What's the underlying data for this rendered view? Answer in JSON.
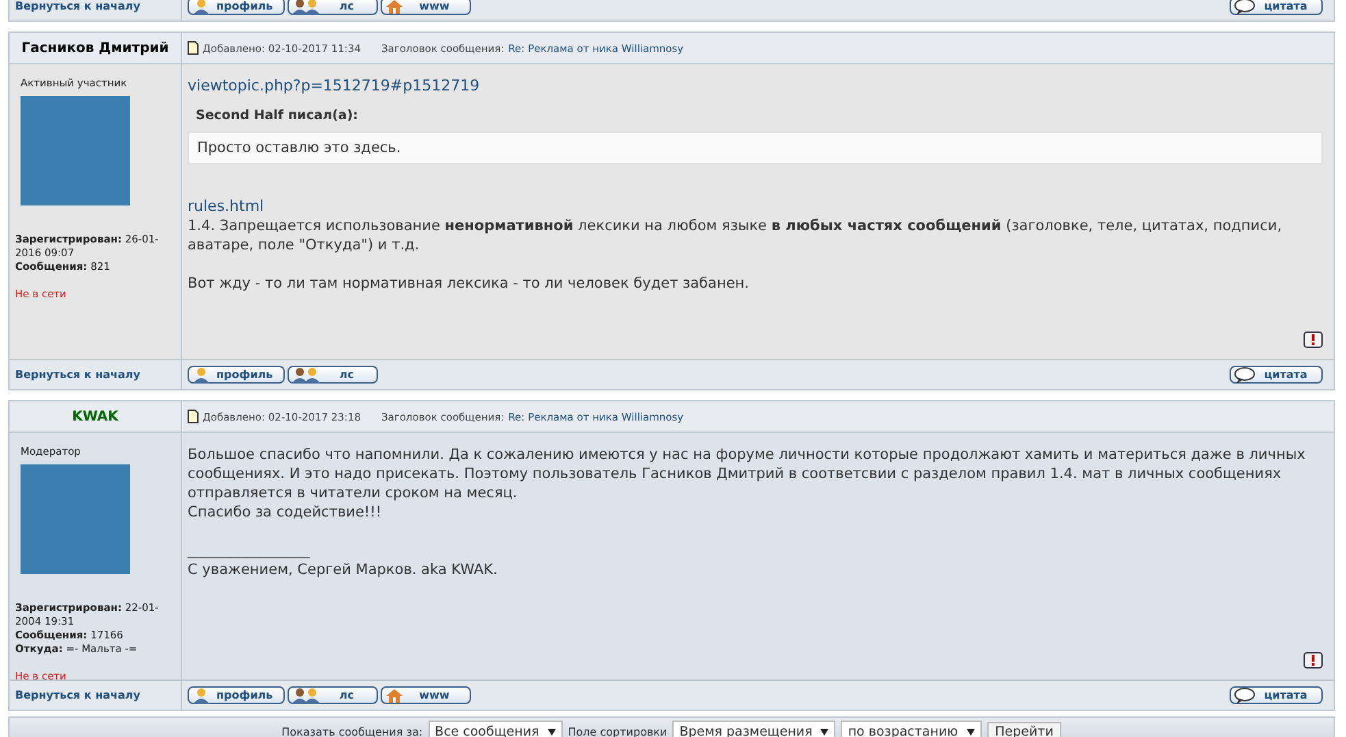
{
  "previous_post_footer": {
    "back_link": "Вернуться к началу",
    "buttons": [
      {
        "kind": "profile",
        "label": "профиль"
      },
      {
        "kind": "pm",
        "label": "лс"
      },
      {
        "kind": "www",
        "label": "www"
      }
    ],
    "quote_button": "цитата"
  },
  "posts": [
    {
      "author": "Гасников Дмитрий",
      "color": "#000000",
      "rank": "Активный участник",
      "info": [
        "**Зарегистрирован:** 26-01-2016 09:07",
        "**Сообщения:** 821"
      ],
      "status": "Не в сети",
      "date": "Добавлено: 02-10-2017 11:34",
      "subject_label": "Заголовок сообщения:",
      "subject": "Re: Реклама от ника Williamnosy",
      "body": [
        {
          "kind": "link",
          "text": "viewtopic.php?p=1512719#p1512719"
        },
        {
          "kind": "quote",
          "title": "Second Half писал(а):",
          "text": "Просто оставлю это здесь."
        },
        {
          "kind": "link",
          "text": "rules.html"
        },
        {
          "kind": "text",
          "text": "1.4. Запрещается использование **ненормативной** лексики на любом языке **в любых частях сообщений** (заголовке, теле, цитатах, подписи, аватаре, поле \"Откуда\") и т.д."
        },
        {
          "kind": "gap"
        },
        {
          "kind": "text",
          "text": "Вот жду - то ли там нормативная лексика - то ли человек будет забанен."
        }
      ],
      "footer": {
        "back_link": "Вернуться к началу",
        "buttons": [
          {
            "kind": "profile",
            "label": "профиль"
          },
          {
            "kind": "pm",
            "label": "лс"
          }
        ],
        "quote_button": "цитата"
      }
    },
    {
      "author": "KWAK",
      "color": "#006600",
      "rank": "Модератор",
      "info": [
        "**Зарегистрирован:** 22-01-2004 19:31",
        "**Сообщения:** 17166",
        "**Откуда:** =- Мальта -="
      ],
      "status": "Не в сети",
      "date": "Добавлено: 02-10-2017 23:18",
      "subject_label": "Заголовок сообщения:",
      "subject": "Re: Реклама от ника Williamnosy",
      "body": [
        {
          "kind": "text",
          "text": "Большое спасибо что напомнили. Да к сожалению имеются у нас на форуме личности которые продолжают хамить и материться даже в личных сообщениях. И это надо присекать. Поэтому пользователь Гасников Дмитрий в соответсвии с разделом правил 1.4. мат в личных сообщениях отправляется в читатели сроком на месяц."
        },
        {
          "kind": "text",
          "text": "Спасибо за содействие!!!"
        },
        {
          "kind": "gap"
        },
        {
          "kind": "text",
          "text": "_________________"
        },
        {
          "kind": "text",
          "text": "С уважением, Сергей Марков. aka KWAK."
        }
      ],
      "footer": {
        "back_link": "Вернуться к началу",
        "buttons": [
          {
            "kind": "profile",
            "label": "профиль"
          },
          {
            "kind": "pm",
            "label": "лс"
          },
          {
            "kind": "www",
            "label": "www"
          }
        ],
        "quote_button": "цитата"
      }
    }
  ],
  "sort_bar": {
    "show_label": "Показать сообщения за:",
    "show_value": "Все сообщения",
    "sort_label": "Поле сортировки",
    "sort_value": "Время размещения",
    "order_value": "по возрастанию",
    "go_button": "Перейти"
  }
}
